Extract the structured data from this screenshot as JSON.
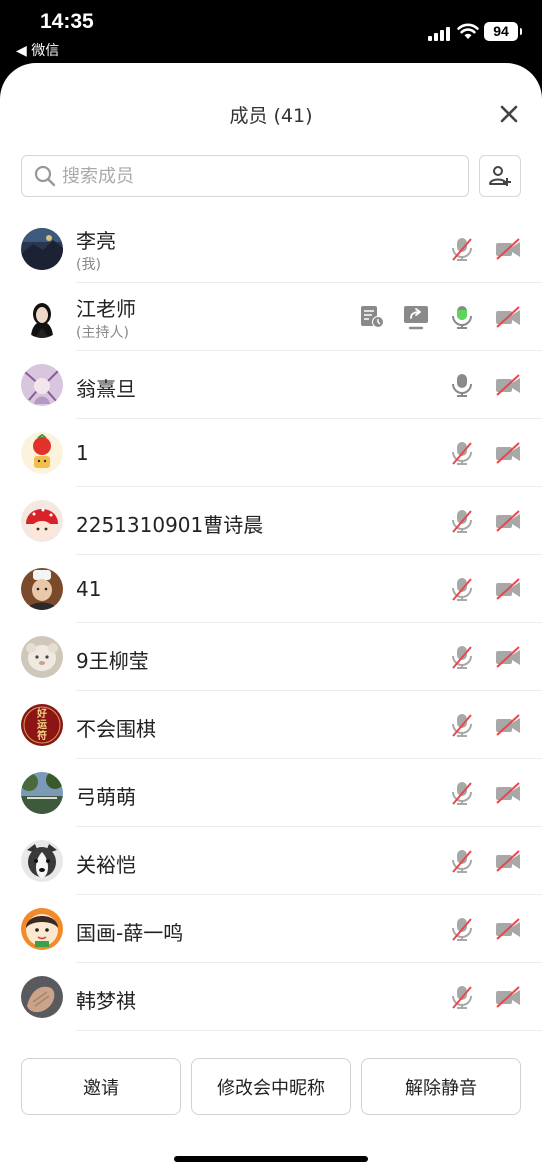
{
  "status_bar": {
    "time": "14:35",
    "back_app": "◀ 微信",
    "battery": "94"
  },
  "sheet": {
    "title": "成员 (41)"
  },
  "search": {
    "placeholder": "搜索成员"
  },
  "members": [
    {
      "name": "李亮",
      "sub": "(我)",
      "mic": "muted",
      "camera": "off",
      "avatar": "mountain-night"
    },
    {
      "name": "江老师",
      "sub": "(主持人)",
      "mic": "active",
      "camera": "off",
      "avatar": "woman-portrait",
      "extra_icons": [
        "document-icon",
        "screen-share-icon"
      ]
    },
    {
      "name": "翁熹旦",
      "sub": "",
      "mic": "on",
      "camera": "off",
      "avatar": "anime-purple"
    },
    {
      "name": "1",
      "sub": "",
      "mic": "muted",
      "camera": "off",
      "avatar": "strawberry-cartoon"
    },
    {
      "name": "2251310901曹诗晨",
      "sub": "",
      "mic": "muted",
      "camera": "off",
      "avatar": "strawberry-hat"
    },
    {
      "name": "41",
      "sub": "",
      "mic": "muted",
      "camera": "off",
      "avatar": "child-hat"
    },
    {
      "name": "9王柳莹",
      "sub": "",
      "mic": "muted",
      "camera": "off",
      "avatar": "plush-toy"
    },
    {
      "name": "不会围棋",
      "sub": "",
      "mic": "muted",
      "camera": "off",
      "avatar": "red-charm",
      "avatar_text": "好运符"
    },
    {
      "name": "弓萌萌",
      "sub": "",
      "mic": "muted",
      "camera": "off",
      "avatar": "trees-sky"
    },
    {
      "name": "关裕恺",
      "sub": "",
      "mic": "muted",
      "camera": "off",
      "avatar": "husky-dog"
    },
    {
      "name": "国画-薛一鸣",
      "sub": "",
      "mic": "muted",
      "camera": "off",
      "avatar": "cartoon-girl"
    },
    {
      "name": "韩梦祺",
      "sub": "",
      "mic": "muted",
      "camera": "off",
      "avatar": "hand-photo"
    }
  ],
  "buttons": {
    "invite": "邀请",
    "rename": "修改会中昵称",
    "unmute": "解除静音"
  },
  "colors": {
    "mic_active": "#5bd65b",
    "mute_slash": "#e8474c",
    "icon_gray": "#8a8a8a"
  }
}
